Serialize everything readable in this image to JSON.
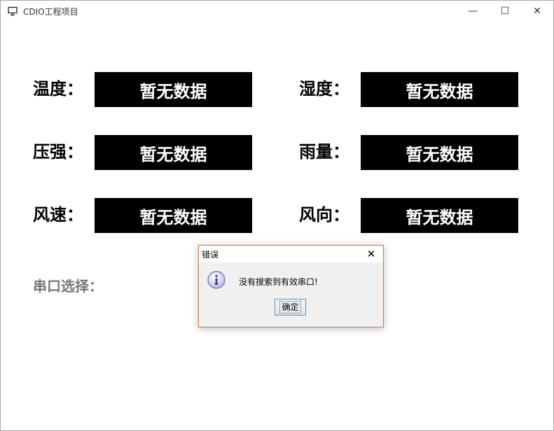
{
  "window": {
    "title": "CDIO工程项目",
    "minimize_glyph": "—",
    "maximize_glyph": "☐",
    "close_glyph": "✕"
  },
  "fields": {
    "temperature": {
      "label": "温度：",
      "value": "暂无数据"
    },
    "humidity": {
      "label": "湿度：",
      "value": "暂无数据"
    },
    "pressure": {
      "label": "压强：",
      "value": "暂无数据"
    },
    "rainfall": {
      "label": "雨量：",
      "value": "暂无数据"
    },
    "wind_speed": {
      "label": "风速：",
      "value": "暂无数据"
    },
    "wind_direction": {
      "label": "风向：",
      "value": "暂无数据"
    }
  },
  "serial": {
    "label": "串口选择："
  },
  "dialog": {
    "title": "错误",
    "message": "没有搜索到有效串口!",
    "ok_label": "确定",
    "close_glyph": "✕",
    "icon": "info-icon"
  },
  "colors": {
    "value_box_bg": "#000000",
    "value_box_text": "#ffffff",
    "serial_label": "#777777",
    "dialog_border": "#c57a4a"
  }
}
